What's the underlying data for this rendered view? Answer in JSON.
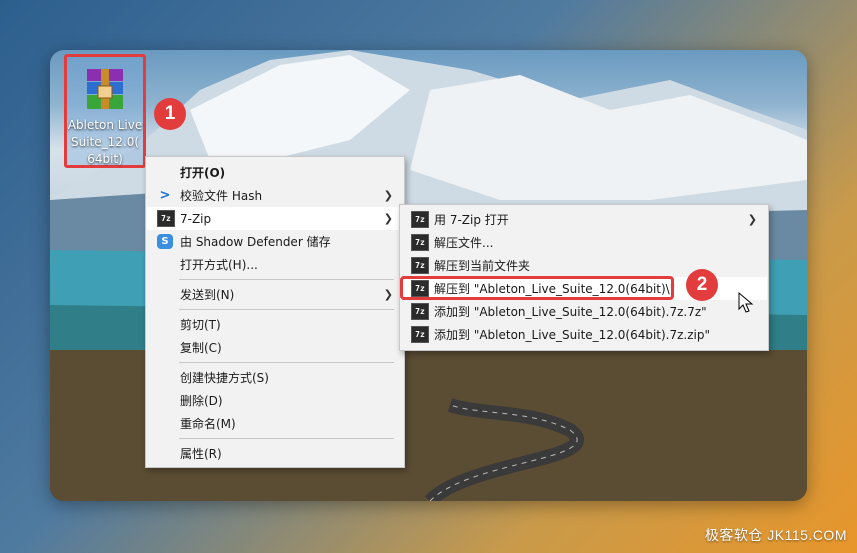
{
  "desktop": {
    "icon_label_line1": "Ableton Live",
    "icon_label_line2": "Suite_12.0(",
    "icon_label_line3": "64bit)"
  },
  "badges": {
    "step1": "1",
    "step2": "2"
  },
  "context_menu": {
    "items": [
      {
        "label": "打开(O)",
        "icon": "none"
      },
      {
        "label": "校验文件 Hash",
        "icon": "hash-icon"
      },
      {
        "label": "7-Zip",
        "icon": "7zip-icon"
      },
      {
        "label": "由 Shadow Defender 储存",
        "icon": "shadow-defender-icon"
      },
      {
        "label": "打开方式(H)...",
        "icon": "none"
      },
      {
        "label": "发送到(N)",
        "icon": "none"
      },
      {
        "label": "剪切(T)",
        "icon": "none"
      },
      {
        "label": "复制(C)",
        "icon": "none"
      },
      {
        "label": "创建快捷方式(S)",
        "icon": "none"
      },
      {
        "label": "删除(D)",
        "icon": "none"
      },
      {
        "label": "重命名(M)",
        "icon": "none"
      },
      {
        "label": "属性(R)",
        "icon": "none"
      }
    ]
  },
  "zip_submenu": {
    "icon_text": "7z",
    "items": [
      {
        "label": "用 7-Zip 打开"
      },
      {
        "label": "解压文件..."
      },
      {
        "label": "解压到当前文件夹"
      },
      {
        "label": "解压到 \"Ableton_Live_Suite_12.0(64bit)\\\""
      },
      {
        "label": "添加到 \"Ableton_Live_Suite_12.0(64bit).7z.7z\""
      },
      {
        "label": "添加到 \"Ableton_Live_Suite_12.0(64bit).7z.zip\""
      }
    ]
  },
  "watermark": "极客软仓 JK115.COM",
  "colors": {
    "highlight_red": "#e23c3c",
    "menu_bg": "#f2f2f2"
  }
}
